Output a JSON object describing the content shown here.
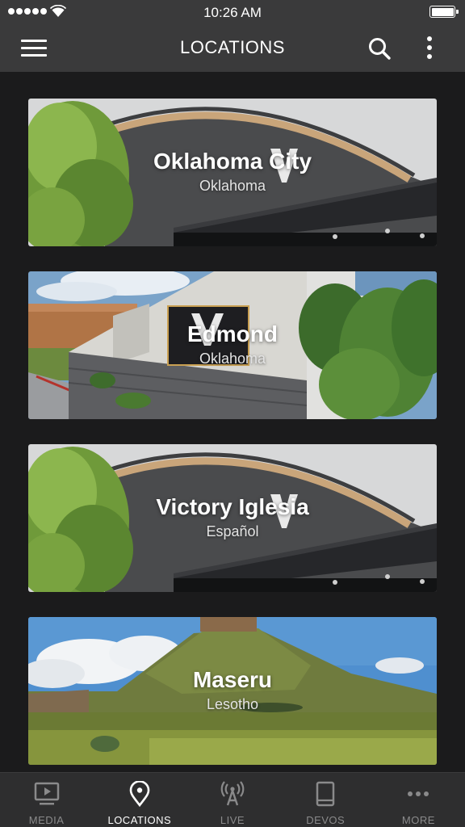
{
  "status_bar": {
    "time": "10:26 AM",
    "signal_icon": "signal-dots-icon",
    "wifi_icon": "wifi-icon",
    "battery_icon": "battery-icon"
  },
  "header": {
    "title": "LOCATIONS",
    "menu_icon": "hamburger-menu-icon",
    "search_icon": "search-icon",
    "more_icon": "vertical-ellipsis-icon"
  },
  "locations": [
    {
      "name": "Oklahoma City",
      "subtitle": "Oklahoma"
    },
    {
      "name": "Edmond",
      "subtitle": "Oklahoma"
    },
    {
      "name": "Victory Iglesia",
      "subtitle": "Español"
    },
    {
      "name": "Maseru",
      "subtitle": "Lesotho"
    }
  ],
  "tabs": [
    {
      "label": "MEDIA",
      "icon": "play-screen-icon",
      "active": false
    },
    {
      "label": "LOCATIONS",
      "icon": "map-pin-icon",
      "active": true
    },
    {
      "label": "LIVE",
      "icon": "broadcast-antenna-icon",
      "active": false
    },
    {
      "label": "DEVOS",
      "icon": "book-icon",
      "active": false
    },
    {
      "label": "MORE",
      "icon": "horizontal-ellipsis-icon",
      "active": false
    }
  ],
  "colors": {
    "bar_background": "#3a3a3b",
    "page_background": "#1b1b1c",
    "tab_bar_background": "#2e2e2f",
    "active_tab": "#ffffff",
    "inactive_tab": "#8a8a8b"
  }
}
